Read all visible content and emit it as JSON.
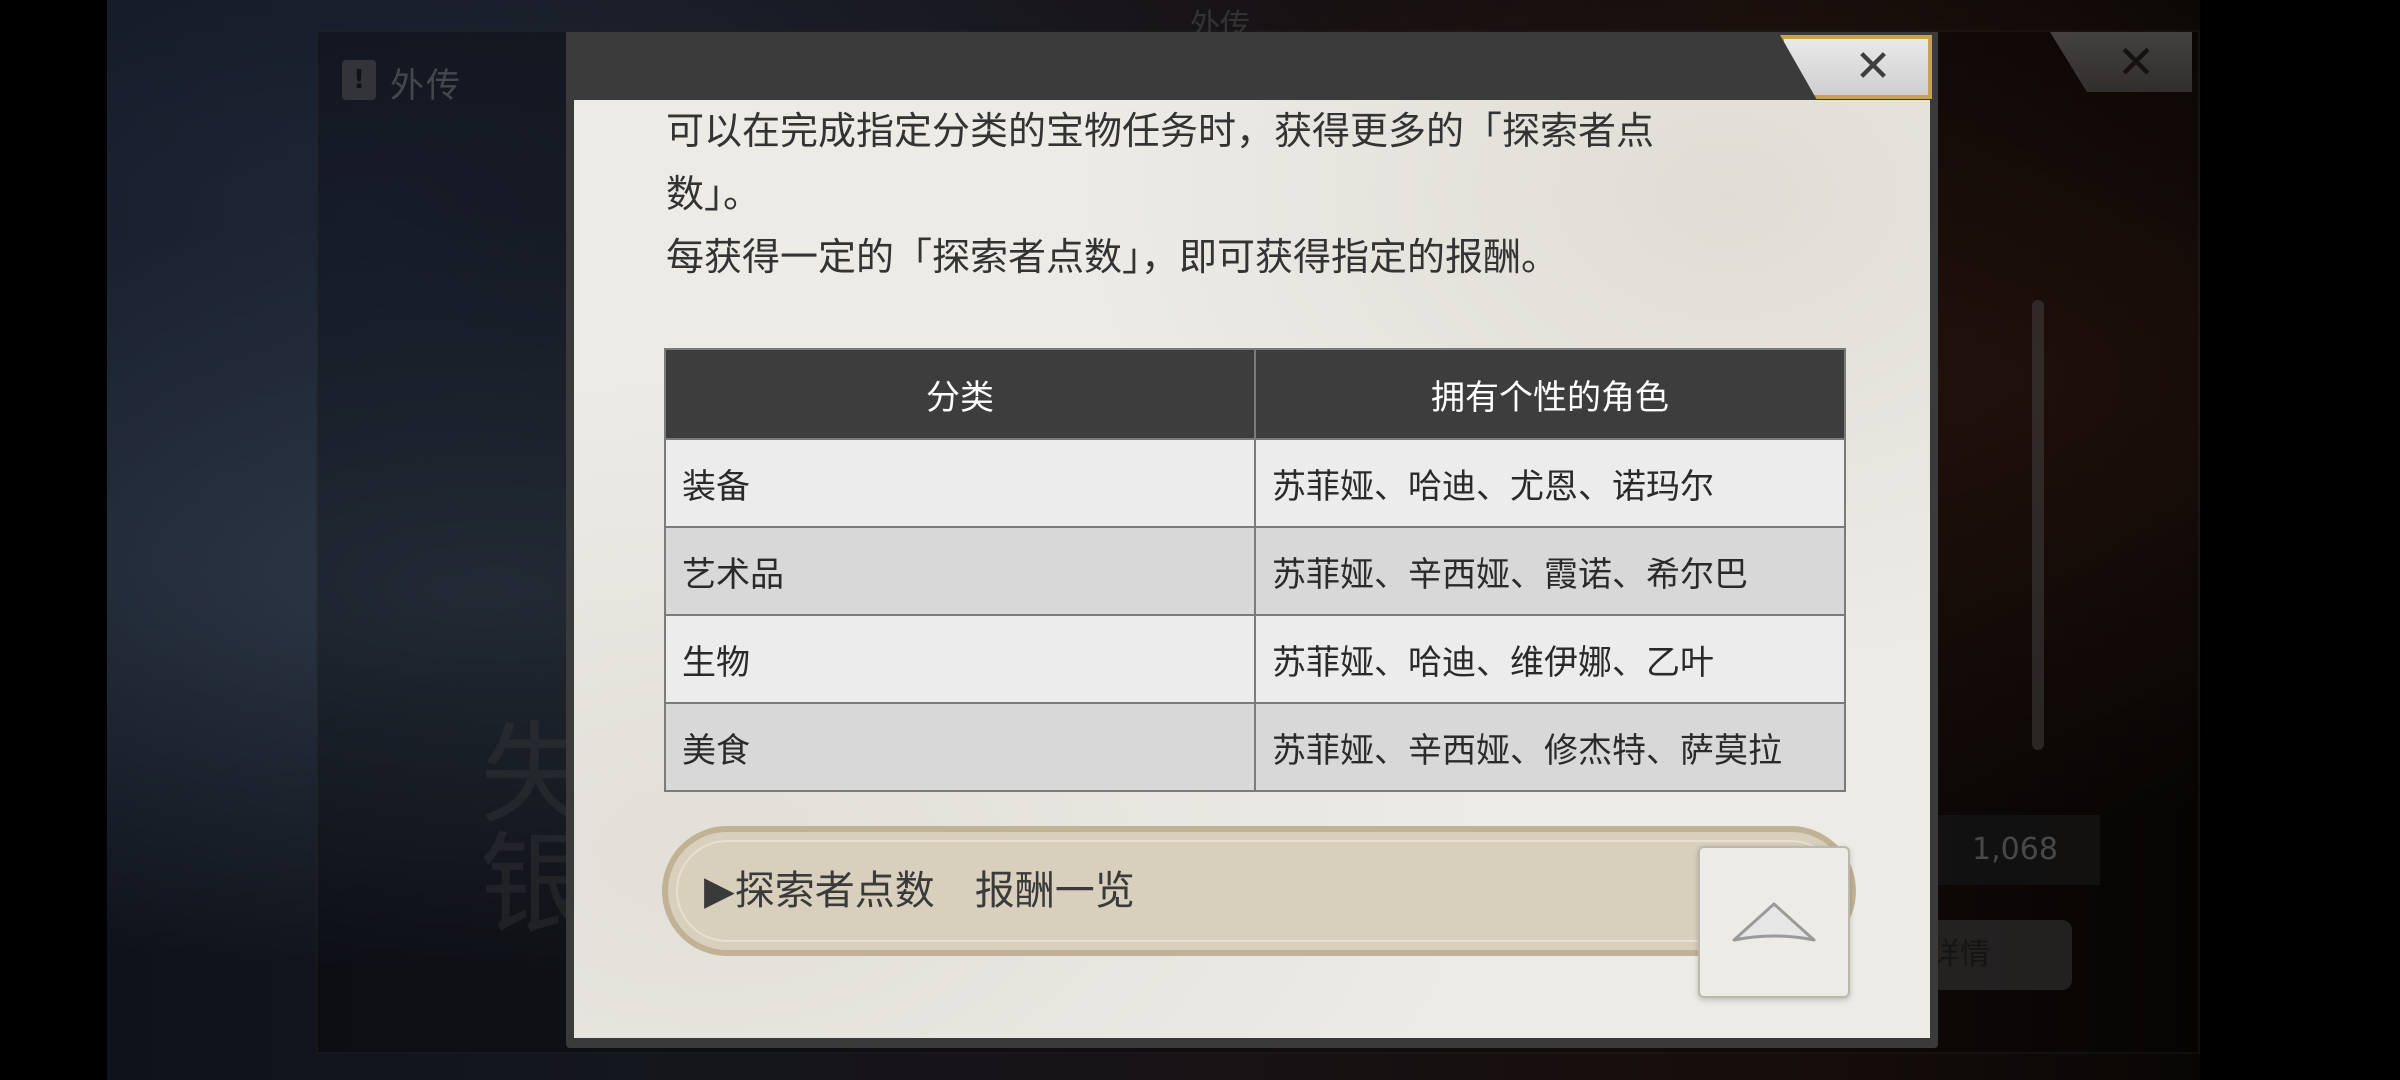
{
  "background": {
    "header_label": "外传",
    "top_tab_label": "外传",
    "header_icon_glyph": "!",
    "value": "1,068",
    "detail_button_label": "详情",
    "character_text": "失\n银",
    "close_glyph": "✕"
  },
  "modal": {
    "close_glyph": "✕",
    "description_lines": [
      "可以在完成指定分类的宝物任务时，获得更多的「探索者点",
      "数」。",
      "每获得一定的「探索者点数」，即可获得指定的报酬。"
    ],
    "table": {
      "headers": [
        "分类",
        "拥有个性的角色"
      ],
      "rows": [
        {
          "category": "装备",
          "characters": "苏菲娅、哈迪、尤恩、诺玛尔"
        },
        {
          "category": "艺术品",
          "characters": "苏菲娅、辛西娅、霞诺、希尔巴"
        },
        {
          "category": "生物",
          "characters": "苏菲娅、哈迪、维伊娜、乙叶"
        },
        {
          "category": "美食",
          "characters": "苏菲娅、辛西娅、修杰特、萨莫拉"
        }
      ]
    },
    "reward_section_label": "▶探索者点数　报酬一览",
    "scroll_top_icon": "up-triangle-icon"
  }
}
